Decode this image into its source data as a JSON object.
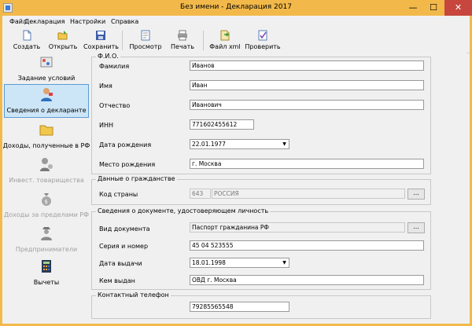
{
  "window": {
    "title": "Без имени - Декларация 2017",
    "minimize": "—",
    "maximize": "☐",
    "close": "✕"
  },
  "menu": [
    "Файл",
    "Декларация",
    "Настройки",
    "Справка"
  ],
  "toolbar": {
    "create": "Создать",
    "open": "Открыть",
    "save": "Сохранить",
    "preview": "Просмотр",
    "print": "Печать",
    "xml": "Файл xml",
    "check": "Проверить"
  },
  "nav": {
    "conditions": "Задание условий",
    "declarant": "Сведения о декларанте",
    "income_rf": "Доходы, полученные в РФ",
    "invest": "Инвест. товарищества",
    "income_abroad": "Доходы за пределами РФ",
    "business": "Предприниматели",
    "deductions": "Вычеты"
  },
  "fio": {
    "legend": "Ф.И.О.",
    "surname_label": "Фамилия",
    "surname": "Иванов",
    "name_label": "Имя",
    "name": "Иван",
    "patronymic_label": "Отчество",
    "patronymic": "Иванович",
    "inn_label": "ИНН",
    "inn": "771602455612",
    "birthdate_label": "Дата рождения",
    "birthdate": "22.01.1977",
    "birthplace_label": "Место рождения",
    "birthplace": "г. Москва"
  },
  "citizenship": {
    "legend": "Данные о гражданстве",
    "country_label": "Код страны",
    "country_code": "643",
    "country_name": "РОССИЯ",
    "button": "..."
  },
  "document": {
    "legend": "Сведения о документе, удостоверяющем личность",
    "type_label": "Вид документа",
    "type": "Паспорт гражданина РФ",
    "button": "...",
    "series_label": "Серия и номер",
    "series": "45 04 523555",
    "issue_date_label": "Дата выдачи",
    "issue_date": "18.01.1998",
    "issued_by_label": "Кем выдан",
    "issued_by": "ОВД г. Москва"
  },
  "contact": {
    "legend": "Контактный телефон",
    "phone": "79285565548"
  },
  "colors": {
    "titlebar": "#f2b94a",
    "close": "#c7463d",
    "selection": "#cde6f7"
  }
}
